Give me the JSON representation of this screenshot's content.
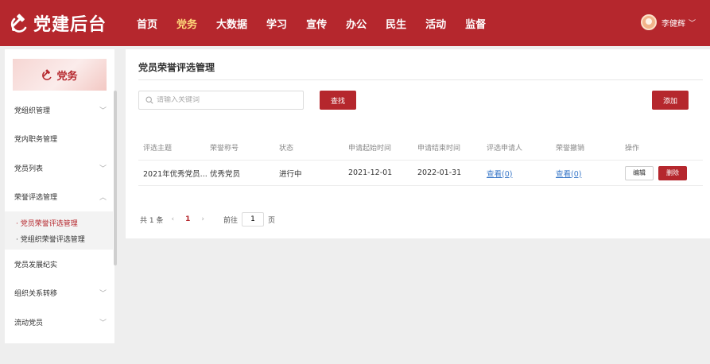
{
  "app": {
    "title": "党建后台",
    "brand_color": "#b5272d"
  },
  "nav": {
    "items": [
      {
        "label": "首页"
      },
      {
        "label": "党务"
      },
      {
        "label": "大数据"
      },
      {
        "label": "学习"
      },
      {
        "label": "宣传"
      },
      {
        "label": "办公"
      },
      {
        "label": "民生"
      },
      {
        "label": "活动"
      },
      {
        "label": "监督"
      }
    ],
    "active": "党务"
  },
  "user": {
    "name": "李健辉"
  },
  "sidebar": {
    "banner_label": "党务",
    "items": [
      {
        "label": "党组织管理",
        "chevron": "chevron-down-icon"
      },
      {
        "label": "党内职务管理"
      },
      {
        "label": "党员列表",
        "chevron": "chevron-down-icon"
      },
      {
        "label": "荣誉评选管理",
        "chevron": "chevron-up-icon"
      },
      {
        "label": "党员发展纪实"
      },
      {
        "label": "组织关系转移",
        "chevron": "chevron-down-icon"
      },
      {
        "label": "流动党员",
        "chevron": "chevron-down-icon"
      }
    ],
    "sub_items": [
      {
        "label": "· 党员荣誉评选管理",
        "active": true
      },
      {
        "label": "· 党组织荣誉评选管理",
        "active": false
      }
    ]
  },
  "main": {
    "title": "党员荣誉评选管理",
    "search": {
      "placeholder": "请输入关键词",
      "value": ""
    },
    "search_button": "查找",
    "add_button": "添加",
    "table": {
      "columns": [
        "评选主题",
        "荣誉称号",
        "状态",
        "申请起始时间",
        "申请结束时间",
        "评选申请人",
        "荣誉撤销",
        "操作"
      ],
      "rows": [
        {
          "theme": "2021年优秀党员...",
          "honor": "优秀党员",
          "status": "进行中",
          "start": "2021-12-01",
          "end": "2022-01-31",
          "applicants": "查看(0)",
          "revoke": "查看(0)",
          "edit": "编辑",
          "delete": "删除"
        }
      ]
    },
    "pager": {
      "total": "共 1 条",
      "prev": "‹",
      "page": "1",
      "next": "›",
      "goto_label": "前往",
      "goto_value": "1",
      "page_suffix": "页"
    }
  }
}
